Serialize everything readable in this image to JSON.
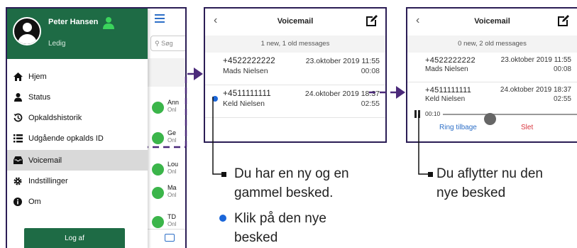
{
  "menu": {
    "user_name": "Peter Hansen",
    "user_status": "Ledig",
    "items": [
      {
        "label": "Hjem",
        "icon": "home-icon"
      },
      {
        "label": "Status",
        "icon": "person-icon"
      },
      {
        "label": "Opkaldshistorik",
        "icon": "history-icon"
      },
      {
        "label": "Udgående opkalds ID",
        "icon": "list-icon"
      },
      {
        "label": "Voicemail",
        "icon": "inbox-icon"
      },
      {
        "label": "Indstillinger",
        "icon": "gear-icon"
      },
      {
        "label": "Om",
        "icon": "info-icon"
      }
    ],
    "logout_label": "Log af"
  },
  "behind": {
    "search_placeholder": "Søg",
    "contacts": [
      {
        "name": "Ann",
        "status": "Onl"
      },
      {
        "name": "Ge",
        "status": "Onl"
      },
      {
        "name": "Lou",
        "status": "Onl"
      },
      {
        "name": "Ma",
        "status": "Onl"
      },
      {
        "name": "TD",
        "status": "Onl"
      }
    ]
  },
  "voicemail_a": {
    "title": "Voicemail",
    "summary": "1 new, 1 old messages",
    "messages": [
      {
        "number": "+4522222222",
        "name": "Mads Nielsen",
        "date": "23.oktober 2019 11:55",
        "duration": "00:08"
      },
      {
        "number": "+4511111111",
        "name": "Keld Nielsen",
        "date": "24.oktober 2019 18:37",
        "duration": "02:55"
      }
    ]
  },
  "voicemail_b": {
    "title": "Voicemail",
    "summary": "0 new, 2 old messages",
    "messages": [
      {
        "number": "+4522222222",
        "name": "Mads Nielsen",
        "date": "23.oktober 2019 11:55",
        "duration": "00:08"
      },
      {
        "number": "+4511111111",
        "name": "Keld Nielsen",
        "date": "24.oktober 2019 18:37",
        "duration": "02:55"
      }
    ],
    "player_time": "00:10",
    "call_back_label": "Ring tilbage",
    "delete_label": "Slet"
  },
  "annotations": {
    "note1_line1": "Du har en ny og en",
    "note1_line2": "gammel besked.",
    "note2_line1": "Klik på den nye",
    "note2_line2": "besked",
    "note3_line1": "Du aflytter nu den",
    "note3_line2": "nye besked"
  },
  "colors": {
    "brand_green": "#1e6b45",
    "accent_blue": "#1a66d9",
    "link_blue": "#2d6fc7",
    "frame_purple": "#2b1d55",
    "delete_red": "#d9363e",
    "status_green": "#3bb54a"
  }
}
